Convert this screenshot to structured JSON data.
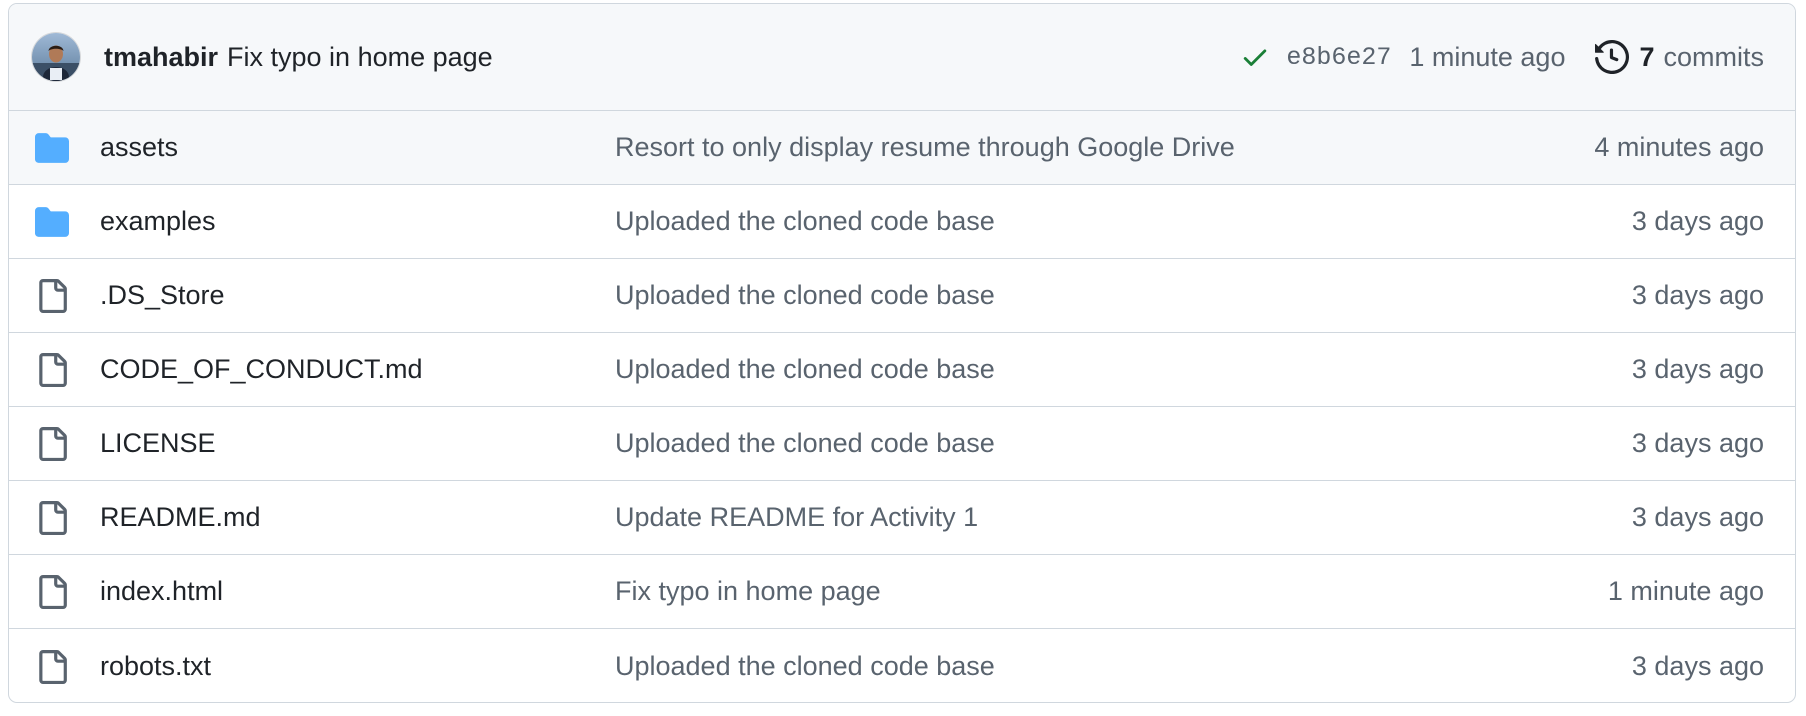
{
  "latest_commit": {
    "author": "tmahabir",
    "message": "Fix typo in home page",
    "status_icon": "check-icon",
    "status_color": "#1a7f37",
    "sha": "e8b6e27",
    "time": "1 minute ago",
    "history_icon": "history-icon",
    "commits_count": "7",
    "commits_label": "commits"
  },
  "files": [
    {
      "type": "folder",
      "icon": "folder-icon",
      "name": "assets",
      "message": "Resort to only display resume through Google Drive",
      "age": "4 minutes ago",
      "highlighted": true
    },
    {
      "type": "folder",
      "icon": "folder-icon",
      "name": "examples",
      "message": "Uploaded the cloned code base",
      "age": "3 days ago"
    },
    {
      "type": "file",
      "icon": "file-icon",
      "name": ".DS_Store",
      "message": "Uploaded the cloned code base",
      "age": "3 days ago"
    },
    {
      "type": "file",
      "icon": "file-icon",
      "name": "CODE_OF_CONDUCT.md",
      "message": "Uploaded the cloned code base",
      "age": "3 days ago"
    },
    {
      "type": "file",
      "icon": "file-icon",
      "name": "LICENSE",
      "message": "Uploaded the cloned code base",
      "age": "3 days ago"
    },
    {
      "type": "file",
      "icon": "file-icon",
      "name": "README.md",
      "message": "Update README for Activity 1",
      "age": "3 days ago"
    },
    {
      "type": "file",
      "icon": "file-icon",
      "name": "index.html",
      "message": "Fix typo in home page",
      "age": "1 minute ago"
    },
    {
      "type": "file",
      "icon": "file-icon",
      "name": "robots.txt",
      "message": "Uploaded the cloned code base",
      "age": "3 days ago"
    }
  ],
  "colors": {
    "folder": "#54aeff",
    "file_icon": "#59636e",
    "muted_text": "#59636e",
    "border": "#d0d7de",
    "header_bg": "#f6f8fa"
  }
}
